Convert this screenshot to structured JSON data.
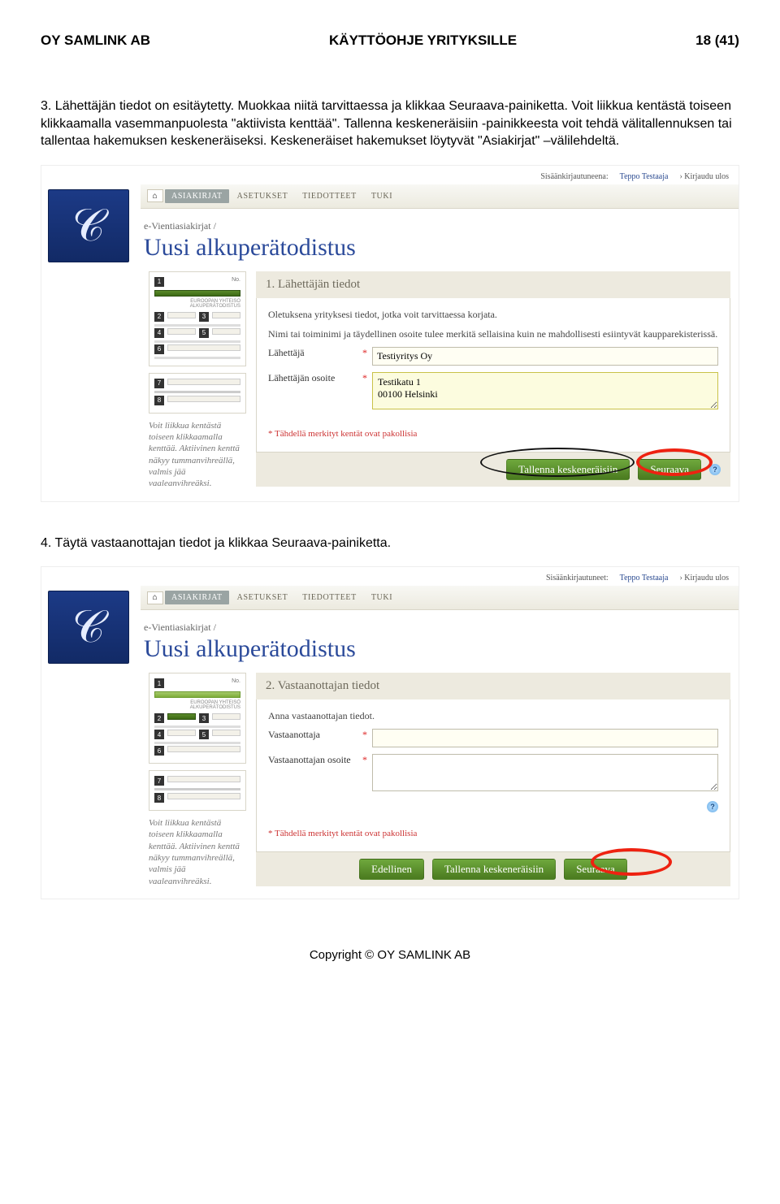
{
  "header": {
    "left": "OY SAMLINK AB",
    "center": "KÄYTTÖOHJE YRITYKSILLE",
    "right": "18 (41)"
  },
  "p1": "3. Lähettäjän tiedot on esitäytetty. Muokkaa niitä tarvittaessa ja klikkaa Seuraava-painiketta. Voit liikkua kentästä toiseen klikkaamalla vasemmanpuolesta \"aktiivista kenttää\". Tallenna keskeneräisiin -painikkeesta voit tehdä välitallennuksen tai tallentaa hakemuksen keskeneräiseksi. Keskeneräiset hakemukset löytyvät \"Asiakirjat\" –välilehdeltä.",
  "p2": "4. Täytä vastaanottajan tiedot ja klikkaa Seuraava-painiketta.",
  "footer": "Copyright © OY SAMLINK AB",
  "topbar": {
    "signed_in_label": "Sisäänkirjautuneena:",
    "signed_in_label2": "Sisäänkirjautuneet:",
    "user": "Teppo Testaaja",
    "logout": "Kirjaudu ulos"
  },
  "tabs": {
    "home": "⌂",
    "t1": "ASIAKIRJAT",
    "t2": "ASETUKSET",
    "t3": "TIEDOTTEET",
    "t4": "TUKI"
  },
  "crumb": "e-Vientiasiakirjat /",
  "title": "Uusi alkuperätodistus",
  "thumb": {
    "no": "No.",
    "euro": "EUROOPAN YHTEISÖ",
    "alku": "ALKUPERÄTODISTUS"
  },
  "nums": {
    "n1": "1",
    "n2": "2",
    "n3": "3",
    "n4": "4",
    "n5": "5",
    "n6": "6",
    "n7": "7",
    "n8": "8"
  },
  "help_text": "Voit liikkua kentästä toiseen klikkaamalla kenttää. Aktiivinen kenttä näkyy tummanvihreällä, valmis jää vaaleanvihreäksi.",
  "s1": {
    "bar": "1. Lähettäjän tiedot",
    "intro1": "Oletuksena yrityksesi tiedot, jotka voit tarvittaessa korjata.",
    "intro2": "Nimi tai toiminimi ja täydellinen osoite tulee merkitä sellaisina kuin ne mahdollisesti esiintyvät kaupparekisterissä.",
    "lbl_sender": "Lähettäjä",
    "val_sender": "Testiyritys Oy",
    "lbl_addr": "Lähettäjän osoite",
    "val_addr": "Testikatu 1\n00100 Helsinki",
    "mand": "* Tähdellä merkityt kentät ovat pakollisia",
    "btn_save": "Tallenna keskeneräisiin",
    "btn_next": "Seuraava"
  },
  "s2": {
    "bar": "2. Vastaanottajan tiedot",
    "intro": "Anna vastaanottajan tiedot.",
    "lbl_recv": "Vastaanottaja",
    "lbl_addr": "Vastaanottajan osoite",
    "mand": "* Tähdellä merkityt kentät ovat pakollisia",
    "btn_prev": "Edellinen",
    "btn_save": "Tallenna keskeneräisiin",
    "btn_next": "Seuraava"
  }
}
